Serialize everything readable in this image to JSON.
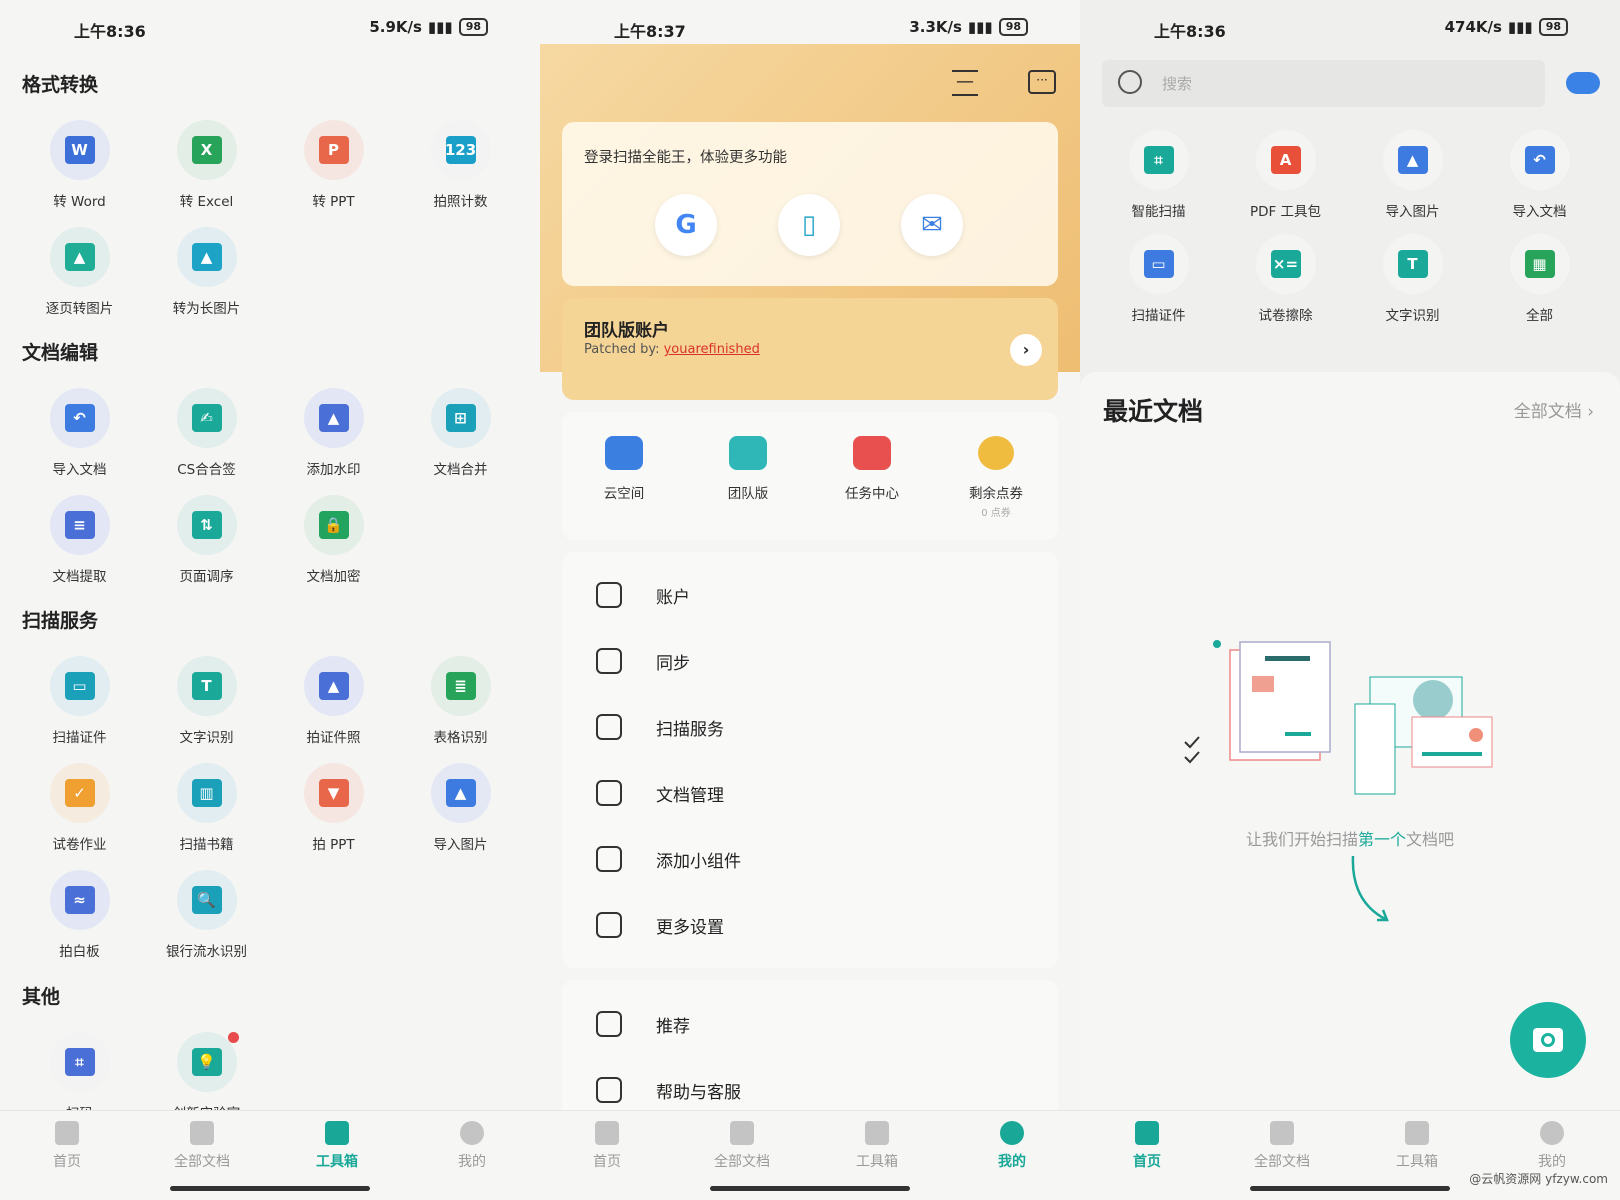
{
  "left": {
    "status": {
      "time": "上午8:36",
      "speed": "5.9K/s",
      "battery": "98"
    },
    "sections": [
      {
        "title": "格式转换",
        "items": [
          {
            "label": "转 Word",
            "icon": "word-icon",
            "color": "#3c6fd8",
            "bg": "#e3e8f4",
            "glyph": "W"
          },
          {
            "label": "转 Excel",
            "icon": "excel-icon",
            "color": "#27a35a",
            "bg": "#e2eee6",
            "glyph": "X"
          },
          {
            "label": "转 PPT",
            "icon": "ppt-icon",
            "color": "#e8674a",
            "bg": "#f6e6e2",
            "glyph": "P"
          },
          {
            "label": "拍照计数",
            "icon": "count-icon",
            "color": "#1aa0c8",
            "bg": "#f3f3f3",
            "glyph": "123"
          },
          {
            "label": "逐页转图片",
            "icon": "image-pages-icon",
            "color": "#1fae95",
            "bg": "#e2eeec",
            "glyph": "▲"
          },
          {
            "label": "转为长图片",
            "icon": "long-image-icon",
            "color": "#1ca3c6",
            "bg": "#e1edf1",
            "glyph": "▲"
          }
        ]
      },
      {
        "title": "文档编辑",
        "items": [
          {
            "label": "导入文档",
            "icon": "import-doc-icon",
            "color": "#3e7be0",
            "bg": "#e3e8f4",
            "glyph": "↶"
          },
          {
            "label": "CS合合签",
            "icon": "signature-icon",
            "color": "#1aa898",
            "bg": "#e2eeec",
            "glyph": "✍"
          },
          {
            "label": "添加水印",
            "icon": "watermark-icon",
            "color": "#4a6fd6",
            "bg": "#e3e6f4",
            "glyph": "▲"
          },
          {
            "label": "文档合并",
            "icon": "merge-icon",
            "color": "#1aa0b8",
            "bg": "#e1edf0",
            "glyph": "⊞"
          },
          {
            "label": "文档提取",
            "icon": "extract-icon",
            "color": "#4a6fd6",
            "bg": "#e3e6f4",
            "glyph": "≡"
          },
          {
            "label": "页面调序",
            "icon": "reorder-icon",
            "color": "#1aa898",
            "bg": "#e2eeec",
            "glyph": "⇅"
          },
          {
            "label": "文档加密",
            "icon": "lock-icon",
            "color": "#22a45e",
            "bg": "#e2eee6",
            "glyph": "🔒"
          }
        ]
      },
      {
        "title": "扫描服务",
        "items": [
          {
            "label": "扫描证件",
            "icon": "id-card-icon",
            "color": "#1aa0b8",
            "bg": "#e1edf0",
            "glyph": "▭"
          },
          {
            "label": "文字识别",
            "icon": "ocr-icon",
            "color": "#1aa898",
            "bg": "#e2eeec",
            "glyph": "T"
          },
          {
            "label": "拍证件照",
            "icon": "id-photo-icon",
            "color": "#4a6fd6",
            "bg": "#e3e6f4",
            "glyph": "▲"
          },
          {
            "label": "表格识别",
            "icon": "table-icon",
            "color": "#27a35a",
            "bg": "#e2eee6",
            "glyph": "≣"
          },
          {
            "label": "试卷作业",
            "icon": "exam-icon",
            "color": "#f0a030",
            "bg": "#f6ebdf",
            "glyph": "✓"
          },
          {
            "label": "扫描书籍",
            "icon": "book-icon",
            "color": "#1aa0b8",
            "bg": "#e1edf0",
            "glyph": "▥"
          },
          {
            "label": "拍 PPT",
            "icon": "ppt-shot-icon",
            "color": "#e8674a",
            "bg": "#f6e6e2",
            "glyph": "▼"
          },
          {
            "label": "导入图片",
            "icon": "import-image-icon",
            "color": "#3e7be0",
            "bg": "#e3e8f4",
            "glyph": "▲"
          },
          {
            "label": "拍白板",
            "icon": "whiteboard-icon",
            "color": "#4a6fd6",
            "bg": "#e3e6f4",
            "glyph": "≈"
          },
          {
            "label": "银行流水识别",
            "icon": "bank-statement-icon",
            "color": "#1aa0b8",
            "bg": "#e1edf0",
            "glyph": "🔍"
          }
        ]
      },
      {
        "title": "其他",
        "items": [
          {
            "label": "扫码",
            "icon": "qr-scan-icon",
            "color": "#4a6fd6",
            "bg": "#f3f3f3",
            "glyph": "⌗"
          },
          {
            "label": "创新实验室",
            "icon": "lab-icon",
            "color": "#1aa898",
            "bg": "#e2eeec",
            "glyph": "💡"
          }
        ]
      }
    ]
  },
  "middle": {
    "status": {
      "time": "上午8:37",
      "speed": "3.3K/s",
      "battery": "98"
    },
    "login_prompt": "登录扫描全能王，体验更多功能",
    "login_options": [
      {
        "icon": "google-icon",
        "glyph": "G"
      },
      {
        "icon": "phone-icon",
        "glyph": "▯"
      },
      {
        "icon": "email-icon",
        "glyph": "✉"
      }
    ],
    "team": {
      "title": "团队版账户",
      "patched_prefix": "Patched by: ",
      "patched_name": "youarefinished"
    },
    "quick": [
      {
        "label": "云空间",
        "icon": "cloud-upload-icon",
        "color": "#3b7fe0"
      },
      {
        "label": "团队版",
        "icon": "team-folder-icon",
        "color": "#2fb6b6"
      },
      {
        "label": "任务中心",
        "icon": "task-center-icon",
        "color": "#e85050"
      },
      {
        "label": "剩余点券",
        "sub": "0 点券",
        "icon": "coupon-icon",
        "color": "#f0bc40"
      }
    ],
    "menu": [
      {
        "label": "账户",
        "icon": "user-icon"
      },
      {
        "label": "同步",
        "icon": "sync-icon"
      },
      {
        "label": "扫描服务",
        "icon": "scan-icon"
      },
      {
        "label": "文档管理",
        "icon": "document-icon"
      },
      {
        "label": "添加小组件",
        "icon": "widget-icon"
      },
      {
        "label": "更多设置",
        "icon": "settings-icon"
      }
    ],
    "menu2": [
      {
        "label": "推荐",
        "icon": "thumbs-up-icon"
      },
      {
        "label": "帮助与客服",
        "icon": "help-icon"
      }
    ]
  },
  "right": {
    "status": {
      "time": "上午8:36",
      "speed": "474K/s",
      "battery": "98"
    },
    "search_placeholder": "搜索",
    "tools": [
      {
        "label": "智能扫描",
        "icon": "smart-scan-icon",
        "color": "#1aa898",
        "glyph": "⌗"
      },
      {
        "label": "PDF 工具包",
        "icon": "pdf-icon",
        "color": "#e8503a",
        "glyph": "A"
      },
      {
        "label": "导入图片",
        "icon": "import-image-icon",
        "color": "#3e7be0",
        "glyph": "▲"
      },
      {
        "label": "导入文档",
        "icon": "import-doc-icon",
        "color": "#3e7be0",
        "glyph": "↶"
      },
      {
        "label": "扫描证件",
        "icon": "id-card-icon",
        "color": "#3e7be0",
        "glyph": "▭"
      },
      {
        "label": "试卷擦除",
        "icon": "exam-erase-icon",
        "color": "#1aa898",
        "glyph": "×="
      },
      {
        "label": "文字识别",
        "icon": "ocr-icon",
        "color": "#1aa898",
        "glyph": "T"
      },
      {
        "label": "全部",
        "icon": "all-tools-icon",
        "color": "#27a35a",
        "glyph": "▦"
      }
    ],
    "recent_title": "最近文档",
    "all_docs": "全部文档",
    "empty_pre": "让我们开始扫描",
    "empty_hl": "第一个",
    "empty_post": "文档吧",
    "watermark": "@云帆资源网 yfzyw.com"
  },
  "nav": {
    "tabs": [
      "首页",
      "全部文档",
      "工具箱",
      "我的"
    ]
  },
  "colors": {
    "accent": "#19a898",
    "header_gold": "#f0c878",
    "link_red": "#d9322a"
  }
}
